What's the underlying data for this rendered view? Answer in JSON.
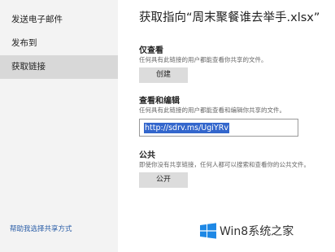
{
  "sidebar": {
    "items": [
      {
        "label": "发送电子邮件"
      },
      {
        "label": "发布到"
      },
      {
        "label": "获取链接"
      }
    ],
    "help_link": "帮助我选择共享方式"
  },
  "main": {
    "title": "获取指向“周末聚餐谁去举手.xlsx”",
    "view_only": {
      "heading": "仅查看",
      "description": "任何具有此链接的用户都能查看你共享的文件。",
      "button_label": "创建"
    },
    "view_edit": {
      "heading": "查看和编辑",
      "description": "任何具有此链接的用户都能查看和编辑你共享的文件。",
      "link_value": "http://sdrv.ms/UgiYRv"
    },
    "public": {
      "heading": "公共",
      "description": "即使你没有共享链接，任何人都可以搜索和查看你的公共文件。",
      "button_label": "公开"
    }
  },
  "watermark": {
    "text": "Win8系统之家",
    "logo_icon": "windows-logo-icon"
  },
  "colors": {
    "sidebar_bg": "#f3f3f3",
    "selected_item_bg": "#d8d8d8",
    "button_bg": "#dcdcdc",
    "selection_highlight": "#3366cc",
    "logo_blue": "#1e88e5"
  }
}
